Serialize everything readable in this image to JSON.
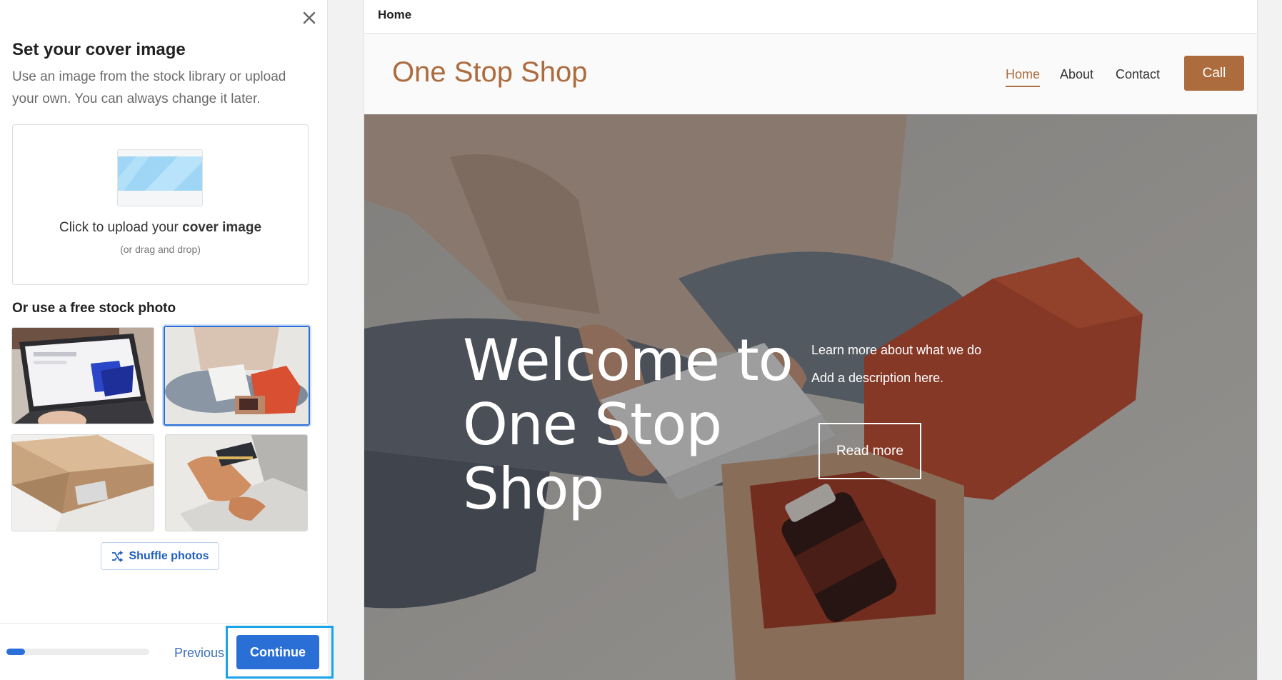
{
  "left_panel": {
    "title": "Set your cover image",
    "subtitle": "Use an image from the stock library or upload your own. You can always change it later.",
    "upload": {
      "prefix": "Click to upload your ",
      "emphasis": "cover image",
      "hint": "(or drag and drop)"
    },
    "stock_title": "Or use a free stock photo",
    "shuffle_label": "Shuffle photos",
    "footer": {
      "progress_fraction": 0.13,
      "previous_label": "Previous",
      "continue_label": "Continue"
    }
  },
  "preview": {
    "tab_label": "Home",
    "logo": "One Stop Shop",
    "nav": {
      "home": "Home",
      "about": "About",
      "contact": "Contact"
    },
    "call_label": "Call",
    "hero": {
      "title": "Welcome to One Stop Shop",
      "desc_line1": "Learn more about what we do",
      "desc_line2": "Add a description here.",
      "read_more": "Read more"
    }
  },
  "colors": {
    "brand": "#ad6c3e",
    "accent_blue": "#2a6fd6",
    "focus_outline": "#1aa3e8"
  }
}
